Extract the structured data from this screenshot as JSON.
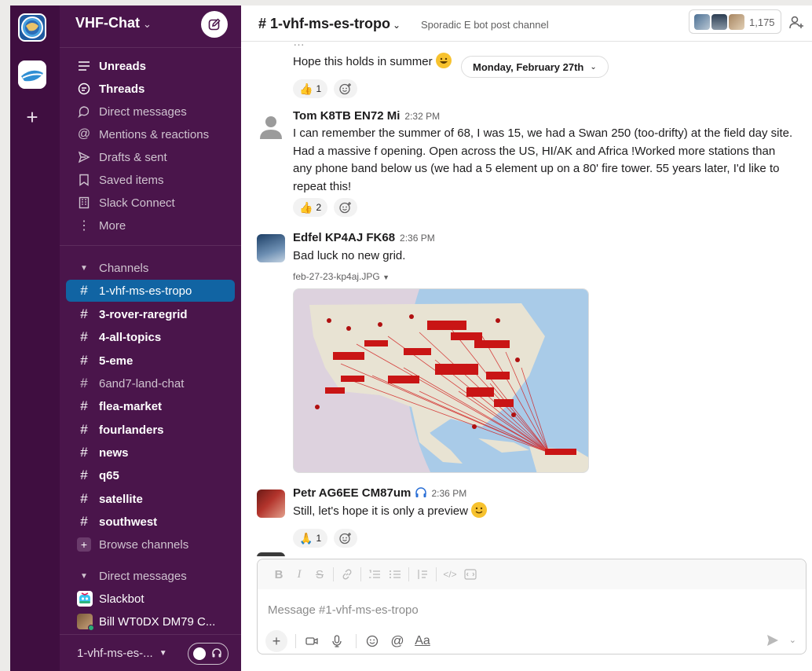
{
  "workspace": {
    "name": "VHF-Chat",
    "nav": [
      {
        "label": "Unreads",
        "icon": "unreads-icon",
        "bold": true
      },
      {
        "label": "Threads",
        "icon": "threads-icon",
        "bold": true
      },
      {
        "label": "Direct messages",
        "icon": "direct-messages-icon",
        "bold": false
      },
      {
        "label": "Mentions & reactions",
        "icon": "at-icon",
        "bold": false
      },
      {
        "label": "Drafts & sent",
        "icon": "send-icon",
        "bold": false
      },
      {
        "label": "Saved items",
        "icon": "bookmark-icon",
        "bold": false
      },
      {
        "label": "Slack Connect",
        "icon": "building-icon",
        "bold": false
      },
      {
        "label": "More",
        "icon": "more-icon",
        "bold": false
      }
    ],
    "channels_header": "Channels",
    "channels": [
      {
        "name": "1-vhf-ms-es-tropo",
        "active": true,
        "unread": false
      },
      {
        "name": "3-rover-raregrid",
        "active": false,
        "unread": true
      },
      {
        "name": "4-all-topics",
        "active": false,
        "unread": true
      },
      {
        "name": "5-eme",
        "active": false,
        "unread": true
      },
      {
        "name": "6and7-land-chat",
        "active": false,
        "unread": false
      },
      {
        "name": "flea-market",
        "active": false,
        "unread": true
      },
      {
        "name": "fourlanders",
        "active": false,
        "unread": true
      },
      {
        "name": "news",
        "active": false,
        "unread": true
      },
      {
        "name": "q65",
        "active": false,
        "unread": true
      },
      {
        "name": "satellite",
        "active": false,
        "unread": true
      },
      {
        "name": "southwest",
        "active": false,
        "unread": true
      }
    ],
    "browse_channels": "Browse channels",
    "dm_header": "Direct messages",
    "dms": [
      "Slackbot",
      "Bill WT0DX DM79 C..."
    ],
    "footer_channel": "1-vhf-ms-es-..."
  },
  "channel": {
    "title": "1-vhf-ms-es-tropo",
    "topic": "Sporadic E bot post channel",
    "member_count": "1,175"
  },
  "messages": {
    "fragment_text": "Hope this holds in summer",
    "fragment_reaction_count": "1",
    "date_divider": "Monday, February 27th",
    "items": [
      {
        "name": "Tom K8TB EN72 Mi",
        "time": "2:32 PM",
        "text": "I can remember the summer of 68, I was 15, we had a Swan 250 (too-drifty) at the field day site. Had a massive f opening. Open across the US, HI/AK and Africa !Worked more stations than any phone band below us (we had a 5 element up on a 80' fire tower. 55 years later, I'd like to repeat this!",
        "reaction_count": "2"
      },
      {
        "name": "Edfel KP4AJ FK68",
        "time": "2:36 PM",
        "text": "Bad luck no new grid.",
        "file": "feb-27-23-kp4aj.JPG"
      },
      {
        "name": "Petr AG6EE CM87um",
        "time": "2:36 PM",
        "text": "Still, let's hope it is only a preview",
        "reaction_count": "1"
      }
    ]
  },
  "composer": {
    "placeholder": "Message #1-vhf-ms-es-tropo",
    "text_format_label": "Aa"
  },
  "colors": {
    "rail": "#3f0e40",
    "sidebar": "#4a154b",
    "active_channel": "#1164a3"
  }
}
